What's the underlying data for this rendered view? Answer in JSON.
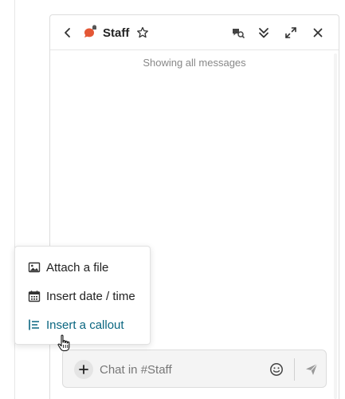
{
  "header": {
    "title": "Staff",
    "back_label": "Back",
    "channel_color": "#e45735"
  },
  "messages": {
    "status_text": "Showing all messages"
  },
  "composer": {
    "placeholder": "Chat in #Staff"
  },
  "menu": {
    "items": [
      {
        "label": "Attach a file",
        "icon": "image-icon"
      },
      {
        "label": "Insert date / time",
        "icon": "calendar-icon"
      },
      {
        "label": "Insert a callout",
        "icon": "callout-icon"
      }
    ],
    "hover_color": "#0a6680"
  },
  "icons": {
    "back": "chevron-left-icon",
    "star": "star-icon",
    "search": "search-messages-icon",
    "jump": "double-chevron-down-icon",
    "expand": "expand-icon",
    "close": "close-icon",
    "plus": "plus-icon",
    "emoji": "emoji-icon",
    "send": "send-icon"
  }
}
